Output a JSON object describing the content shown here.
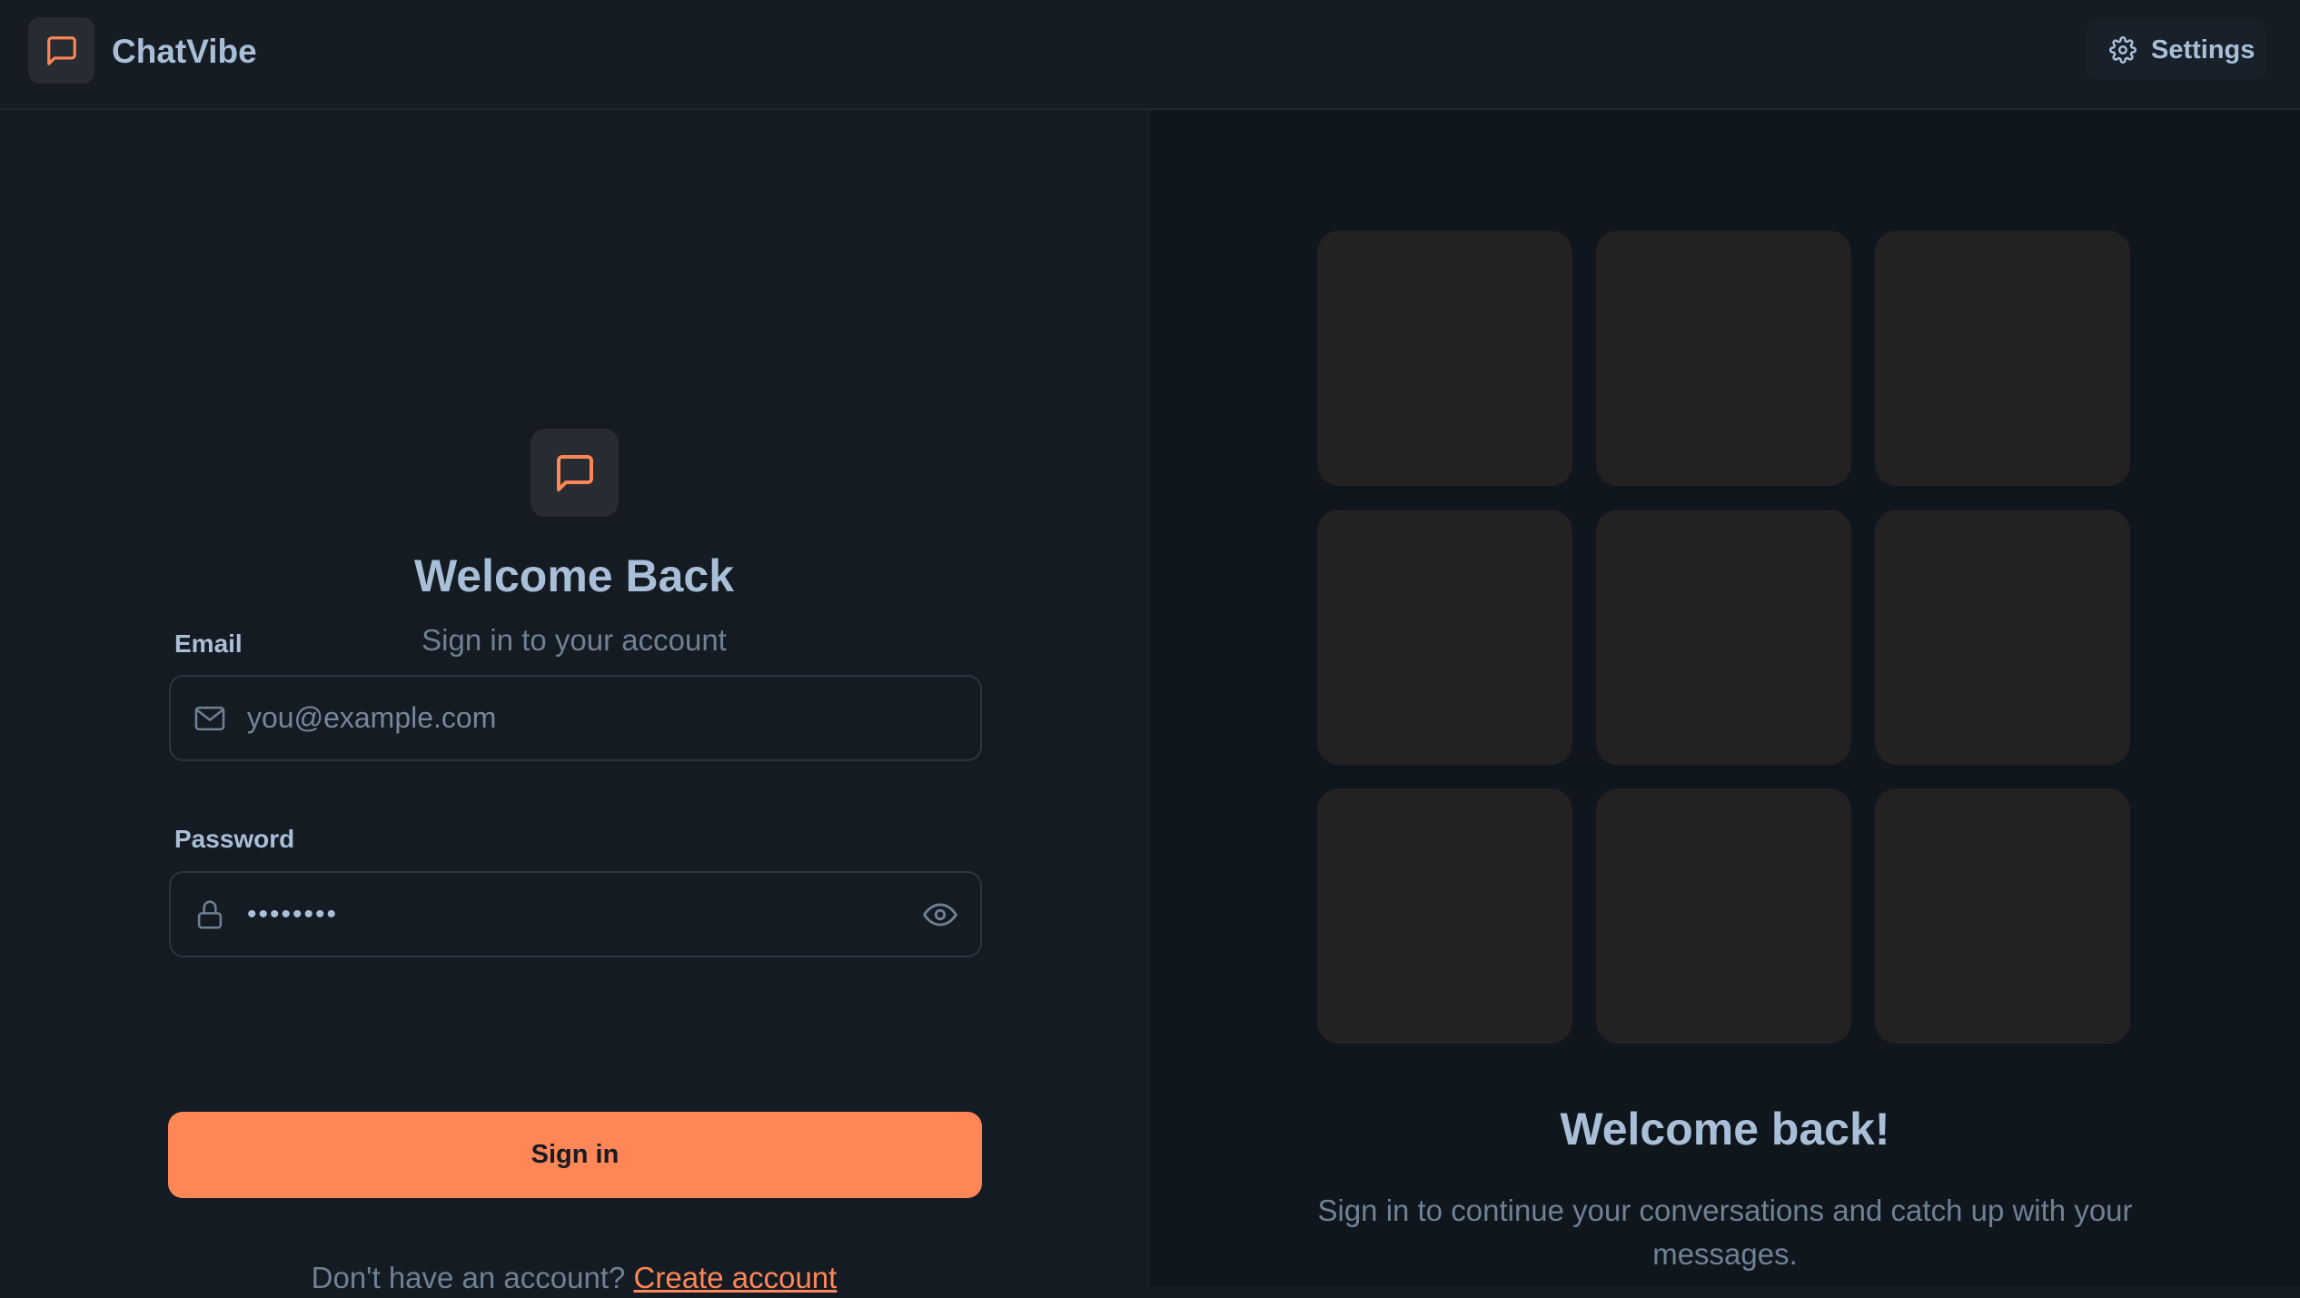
{
  "app": {
    "name": "ChatVibe",
    "logo_icon": "chat-bubble-icon",
    "accent_color": "#ff8656"
  },
  "header": {
    "settings_label": "Settings",
    "settings_icon": "gear-icon"
  },
  "login": {
    "title": "Welcome Back",
    "subtitle": "Sign in to your account",
    "email": {
      "label": "Email",
      "placeholder": "you@example.com",
      "value": "",
      "icon": "mail-icon"
    },
    "password": {
      "label": "Password",
      "value_masked": "••••••••",
      "icon": "lock-icon",
      "toggle_icon": "eye-icon"
    },
    "submit_label": "Sign in",
    "signup_prompt": "Don't have an account?",
    "signup_link": "Create account"
  },
  "promo": {
    "tile_count": 9,
    "title": "Welcome back!",
    "text": "Sign in to continue your conversations and catch up with your messages."
  }
}
